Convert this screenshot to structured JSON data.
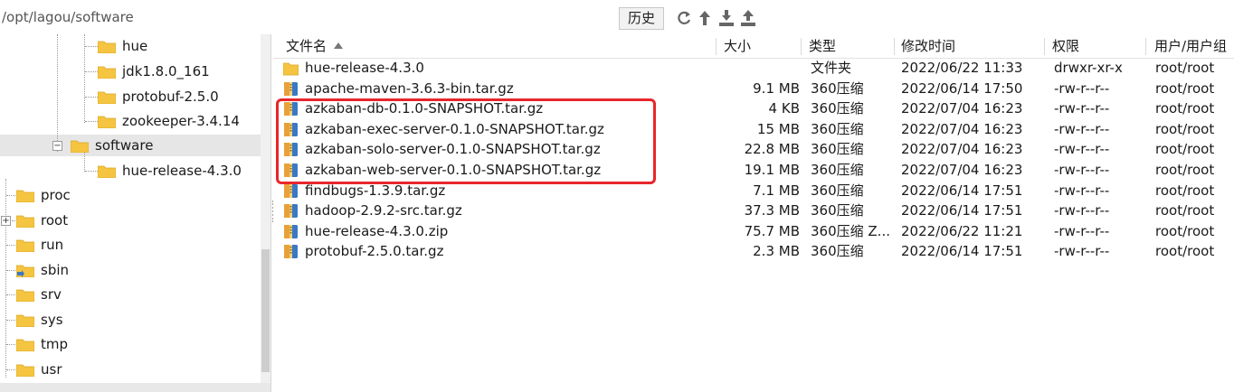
{
  "pathbar": {
    "path": "/opt/lagou/software",
    "history_label": "历史"
  },
  "tree": {
    "items": [
      {
        "label": "hue"
      },
      {
        "label": "jdk1.8.0_161"
      },
      {
        "label": "protobuf-2.5.0"
      },
      {
        "label": "zookeeper-3.4.14"
      },
      {
        "label": "software",
        "selected": true,
        "expander": "−"
      },
      {
        "label": "hue-release-4.3.0"
      },
      {
        "label": "proc"
      },
      {
        "label": "root",
        "expander": "+"
      },
      {
        "label": "run"
      },
      {
        "label": "sbin"
      },
      {
        "label": "srv"
      },
      {
        "label": "sys"
      },
      {
        "label": "tmp"
      },
      {
        "label": "usr"
      }
    ]
  },
  "columns": {
    "name": "文件名",
    "size": "大小",
    "type": "类型",
    "modified": "修改时间",
    "perms": "权限",
    "owner": "用户/用户组"
  },
  "files": [
    {
      "name": "hue-release-4.3.0",
      "size": "",
      "type": "文件夹",
      "modified": "2022/06/22 11:33",
      "perms": "drwxr-xr-x",
      "owner": "root/root",
      "icon": "folder-icon"
    },
    {
      "name": "apache-maven-3.6.3-bin.tar.gz",
      "size": "9.1 MB",
      "type": "360压缩",
      "modified": "2022/06/14 17:50",
      "perms": "-rw-r--r--",
      "owner": "root/root",
      "icon": "archive-icon"
    },
    {
      "name": "azkaban-db-0.1.0-SNAPSHOT.tar.gz",
      "size": "4 KB",
      "type": "360压缩",
      "modified": "2022/07/04 16:23",
      "perms": "-rw-r--r--",
      "owner": "root/root",
      "icon": "archive-icon"
    },
    {
      "name": "azkaban-exec-server-0.1.0-SNAPSHOT.tar.gz",
      "size": "15 MB",
      "type": "360压缩",
      "modified": "2022/07/04 16:23",
      "perms": "-rw-r--r--",
      "owner": "root/root",
      "icon": "archive-icon"
    },
    {
      "name": "azkaban-solo-server-0.1.0-SNAPSHOT.tar.gz",
      "size": "22.8 MB",
      "type": "360压缩",
      "modified": "2022/07/04 16:23",
      "perms": "-rw-r--r--",
      "owner": "root/root",
      "icon": "archive-icon"
    },
    {
      "name": "azkaban-web-server-0.1.0-SNAPSHOT.tar.gz",
      "size": "19.1 MB",
      "type": "360压缩",
      "modified": "2022/07/04 16:23",
      "perms": "-rw-r--r--",
      "owner": "root/root",
      "icon": "archive-icon"
    },
    {
      "name": "findbugs-1.3.9.tar.gz",
      "size": "7.1 MB",
      "type": "360压缩",
      "modified": "2022/06/14 17:51",
      "perms": "-rw-r--r--",
      "owner": "root/root",
      "icon": "archive-icon"
    },
    {
      "name": "hadoop-2.9.2-src.tar.gz",
      "size": "37.3 MB",
      "type": "360压缩",
      "modified": "2022/06/14 17:51",
      "perms": "-rw-r--r--",
      "owner": "root/root",
      "icon": "archive-icon"
    },
    {
      "name": "hue-release-4.3.0.zip",
      "size": "75.7 MB",
      "type": "360压缩 Z...",
      "modified": "2022/06/22 11:21",
      "perms": "-rw-r--r--",
      "owner": "root/root",
      "icon": "archive-icon"
    },
    {
      "name": "protobuf-2.5.0.tar.gz",
      "size": "2.3 MB",
      "type": "360压缩",
      "modified": "2022/06/14 17:51",
      "perms": "-rw-r--r--",
      "owner": "root/root",
      "icon": "archive-icon"
    }
  ],
  "colors": {
    "highlight": "#e8262c",
    "folder": "#f5c542",
    "archive_blue": "#3a78c4",
    "archive_orange": "#e8a13a"
  }
}
